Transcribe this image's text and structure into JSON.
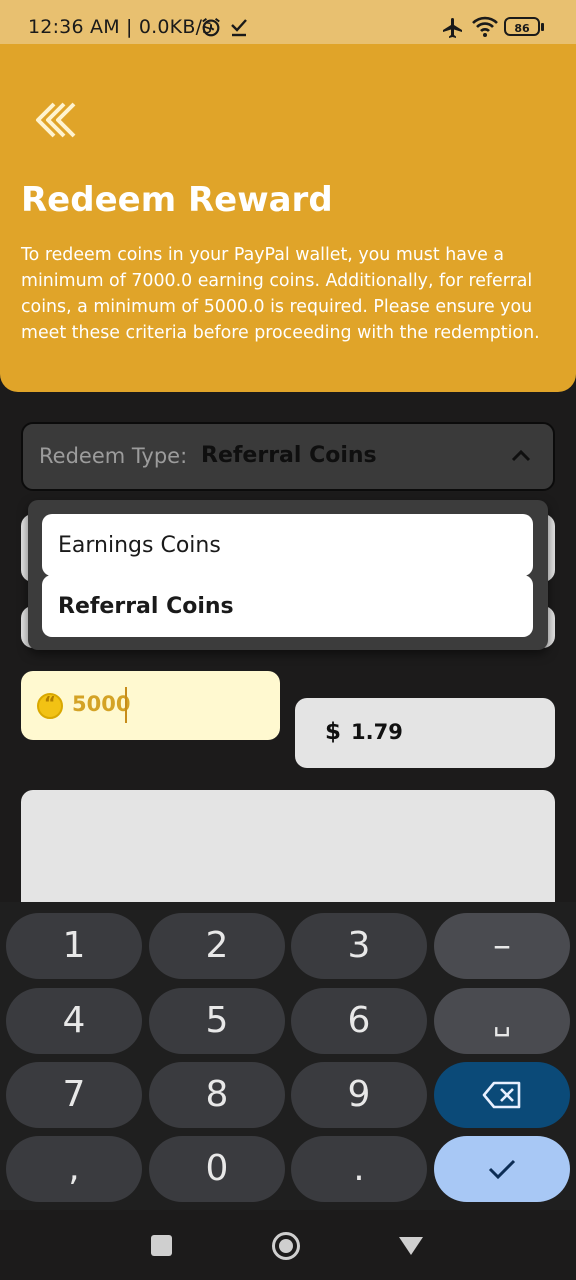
{
  "status_bar": {
    "time": "12:36 AM | 0.0KB/s",
    "battery": "86"
  },
  "header": {
    "title": "Redeem Reward",
    "description": "To redeem coins in your PayPal wallet, you must have a minimum of 7000.0 earning coins. Additionally, for referral coins, a minimum of 5000.0 is required. Please ensure you meet these criteria before proceeding with the redemption."
  },
  "form": {
    "redeem_type_label": "Redeem Type:",
    "redeem_type_value": "Referral Coins",
    "dropdown_options": [
      "Earnings Coins",
      "Referral Coins"
    ],
    "coins_value": "5000",
    "dollar_symbol": "$",
    "dollar_value": "1.79"
  },
  "keyboard": {
    "keys": [
      "1",
      "2",
      "3",
      "–",
      "4",
      "5",
      "6",
      "␣",
      "7",
      "8",
      "9",
      "⌫",
      ",",
      "0",
      ".",
      "✓"
    ]
  },
  "colors": {
    "header_bg": "#e0a429",
    "status_bg": "#e8c070",
    "coin_field_bg": "#fff9d0",
    "confirm_key": "#a8c8f5",
    "delete_key": "#0b4a78"
  }
}
